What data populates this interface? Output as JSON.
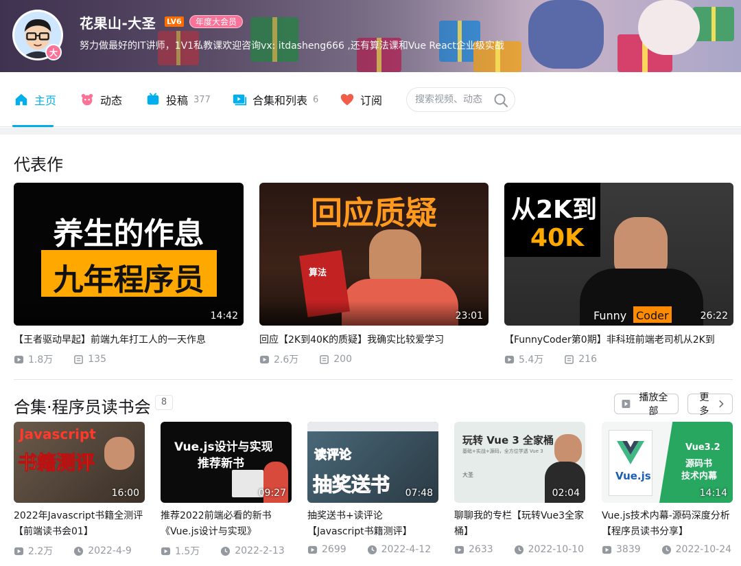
{
  "profile": {
    "name": "花果山-大圣",
    "level": "LV6",
    "vip_badge": "年度大会员",
    "avatar_badge": "大",
    "signature": "努力做最好的IT讲师，1V1私教课欢迎咨询vx: itdasheng666 ,还有算法课和Vue React企业级实战"
  },
  "nav": {
    "items": [
      {
        "label": "主页",
        "count": "",
        "icon": "home-icon",
        "active": true
      },
      {
        "label": "动态",
        "count": "",
        "icon": "dynamic-icon"
      },
      {
        "label": "投稿",
        "count": "377",
        "icon": "upload-icon"
      },
      {
        "label": "合集和列表",
        "count": "6",
        "icon": "collection-icon"
      },
      {
        "label": "订阅",
        "count": "",
        "icon": "heart-icon"
      }
    ],
    "search_placeholder": "搜索视频、动态"
  },
  "masterpiece": {
    "title": "代表作",
    "videos": [
      {
        "title": "【王者驱动早起】前端九年打工人的一天作息",
        "duration": "14:42",
        "plays": "1.8万",
        "comments": "135",
        "thumb_text": [
          "养生的作息",
          "九年程序员"
        ]
      },
      {
        "title": "回应【2K到40K的质疑】我确实比较爱学习",
        "duration": "23:01",
        "plays": "2.6万",
        "comments": "200",
        "thumb_text": [
          "回应质疑",
          "算法"
        ]
      },
      {
        "title": "【FunnyCoder第0期】非科班前端老司机从2K到",
        "duration": "26:22",
        "plays": "5.4万",
        "comments": "216",
        "thumb_text": [
          "从2K到",
          "40K",
          "Funny",
          "Coder"
        ]
      }
    ]
  },
  "collection": {
    "title": "合集·程序员读书会",
    "count": "8",
    "play_all": "播放全部",
    "more": "更多",
    "videos": [
      {
        "title": "2022年Javascript书籍全测评【前端读书会01】",
        "duration": "16:00",
        "plays": "2.2万",
        "date": "2022-4-9",
        "thumb_text": [
          "Javascript",
          "书籍测评"
        ]
      },
      {
        "title": "推荐2022前端必看的新书《Vue.js设计与实现》",
        "duration": "09:27",
        "plays": "1.5万",
        "date": "2022-2-13",
        "thumb_text": [
          "Vue.js设计与实现",
          "推荐新书"
        ]
      },
      {
        "title": "抽奖送书+读评论【Javascript书籍测评】",
        "duration": "07:48",
        "plays": "2699",
        "date": "2022-4-12",
        "thumb_text": [
          "读评论",
          "抽奖送书"
        ]
      },
      {
        "title": "聊聊我的专栏【玩转Vue3全家桶】",
        "duration": "02:04",
        "plays": "2633",
        "date": "2022-10-10",
        "thumb_text": [
          "玩转 Vue 3 全家桶",
          "基础+实战+源码，全方位学透 Vue 3",
          "大圣"
        ]
      },
      {
        "title": "Vue.js技术内幕-源码深度分析【程序员读书分享】",
        "duration": "14:14",
        "plays": "3839",
        "date": "2022-10-24",
        "thumb_text": [
          "Vue.js",
          "Vue3.2",
          "源码书",
          "技术内幕"
        ]
      }
    ]
  },
  "colors": {
    "accent": "#00aeec",
    "pink": "#fb7299",
    "level": "#ff6c00",
    "muted": "#9499a0"
  }
}
